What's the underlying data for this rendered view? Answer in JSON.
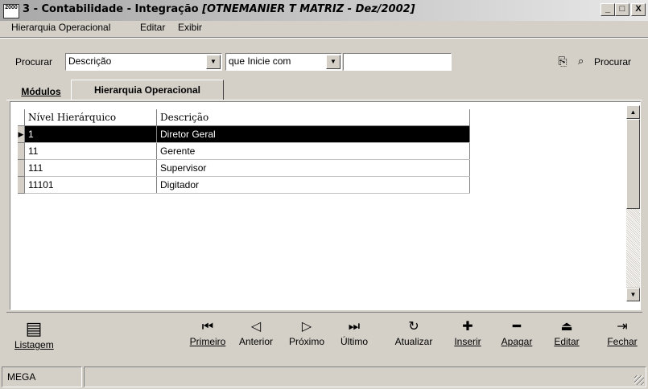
{
  "window": {
    "icon_text": "2000",
    "title_main": "3 - Contabilidade - Integração",
    "title_context": "[OTNEMANIER T MATRIZ - Dez/2002]",
    "controls": {
      "minimize": "_",
      "maximize": "□",
      "close": "X"
    }
  },
  "menu": [
    "Hierarquia Operacional",
    "Editar",
    "Exibir"
  ],
  "search": {
    "label": "Procurar",
    "field": "Descrição",
    "mode": "que Inicie com",
    "value": "",
    "button_label": "Procurar"
  },
  "tabs": [
    {
      "label": "Módulos",
      "active": false
    },
    {
      "label": "Hierarquia Operacional",
      "active": true
    }
  ],
  "grid": {
    "columns": [
      "Nível Hierárquico",
      "Descrição"
    ],
    "rows": [
      {
        "nivel": "1",
        "descricao": "Diretor Geral",
        "selected": true
      },
      {
        "nivel": "11",
        "descricao": "Gerente",
        "selected": false
      },
      {
        "nivel": "111",
        "descricao": "Supervisor",
        "selected": false
      },
      {
        "nivel": "11101",
        "descricao": "Digitador",
        "selected": false
      }
    ],
    "selected_indicator": "▶"
  },
  "toolbar": {
    "listagem": "Listagem",
    "primeiro": "Primeiro",
    "anterior": "Anterior",
    "proximo": "Próximo",
    "ultimo": "Último",
    "atualizar": "Atualizar",
    "inserir": "Inserir",
    "apagar": "Apagar",
    "editar": "Editar",
    "fechar": "Fechar"
  },
  "status": {
    "panel1": "MEGA",
    "panel2": ""
  },
  "colors": {
    "selected_row_bg": "#000000",
    "selected_row_fg": "#ffffff",
    "face": "#d4d0c8"
  }
}
